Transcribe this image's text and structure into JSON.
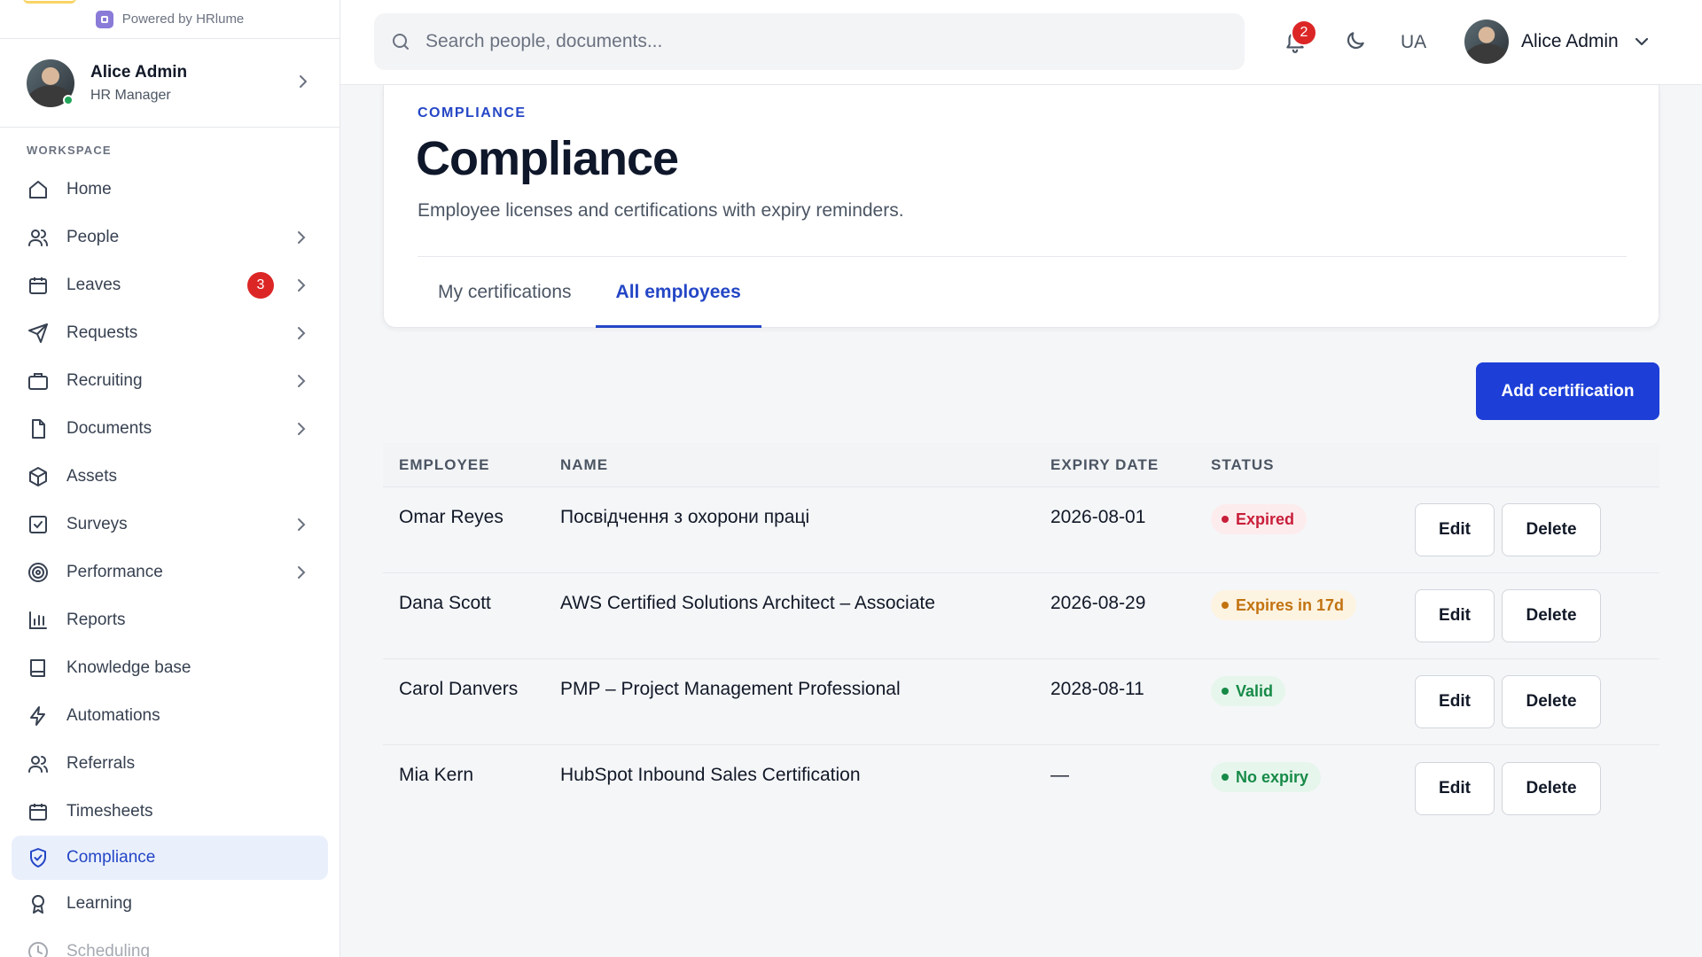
{
  "brand": {
    "powered_by": "Powered by HRlume"
  },
  "profile": {
    "name": "Alice Admin",
    "role": "HR Manager"
  },
  "sidebar": {
    "section_label": "WORKSPACE",
    "items": [
      {
        "label": "Home",
        "icon": "home-icon"
      },
      {
        "label": "People",
        "icon": "people-icon"
      },
      {
        "label": "Leaves",
        "icon": "calendar-icon",
        "badge": "3"
      },
      {
        "label": "Requests",
        "icon": "send-icon"
      },
      {
        "label": "Recruiting",
        "icon": "briefcase-icon"
      },
      {
        "label": "Documents",
        "icon": "document-icon"
      },
      {
        "label": "Assets",
        "icon": "cube-icon"
      },
      {
        "label": "Surveys",
        "icon": "checkbox-icon"
      },
      {
        "label": "Performance",
        "icon": "target-icon"
      },
      {
        "label": "Reports",
        "icon": "bar-chart-icon"
      },
      {
        "label": "Knowledge base",
        "icon": "book-icon"
      },
      {
        "label": "Automations",
        "icon": "bolt-icon"
      },
      {
        "label": "Referrals",
        "icon": "people-icon"
      },
      {
        "label": "Timesheets",
        "icon": "calendar-icon"
      },
      {
        "label": "Compliance",
        "icon": "shield-check-icon",
        "active": true
      },
      {
        "label": "Learning",
        "icon": "award-icon"
      },
      {
        "label": "Scheduling",
        "icon": "clock-icon"
      }
    ]
  },
  "topbar": {
    "search_placeholder": "Search people, documents...",
    "notifications_count": "2",
    "language": "UA",
    "user_name": "Alice Admin"
  },
  "page": {
    "eyebrow": "COMPLIANCE",
    "title": "Compliance",
    "subtitle": "Employee licenses and certifications with expiry reminders.",
    "tabs": [
      {
        "label": "My certifications",
        "active": false
      },
      {
        "label": "All employees",
        "active": true
      }
    ],
    "add_button": "Add certification"
  },
  "table": {
    "columns": [
      "EMPLOYEE",
      "NAME",
      "EXPIRY DATE",
      "STATUS"
    ],
    "edit_label": "Edit",
    "delete_label": "Delete",
    "rows": [
      {
        "employee": "Omar Reyes",
        "name": "Посвідчення з охорони праці",
        "expiry": "2026-08-01",
        "status": "Expired",
        "status_type": "expired"
      },
      {
        "employee": "Dana Scott",
        "name": "AWS Certified Solutions Architect – Associate",
        "expiry": "2026-08-29",
        "status": "Expires in 17d",
        "status_type": "soon"
      },
      {
        "employee": "Carol Danvers",
        "name": "PMP – Project Management Professional",
        "expiry": "2028-08-11",
        "status": "Valid",
        "status_type": "valid"
      },
      {
        "employee": "Mia Kern",
        "name": "HubSpot Inbound Sales Certification",
        "expiry": "—",
        "status": "No expiry",
        "status_type": "valid"
      }
    ]
  },
  "colors": {
    "accent": "#2446c6",
    "primary_button": "#1d3fd8",
    "badge_red": "#dc2626",
    "expired": "#c81e3a",
    "warning": "#c27310",
    "valid": "#178a48"
  }
}
